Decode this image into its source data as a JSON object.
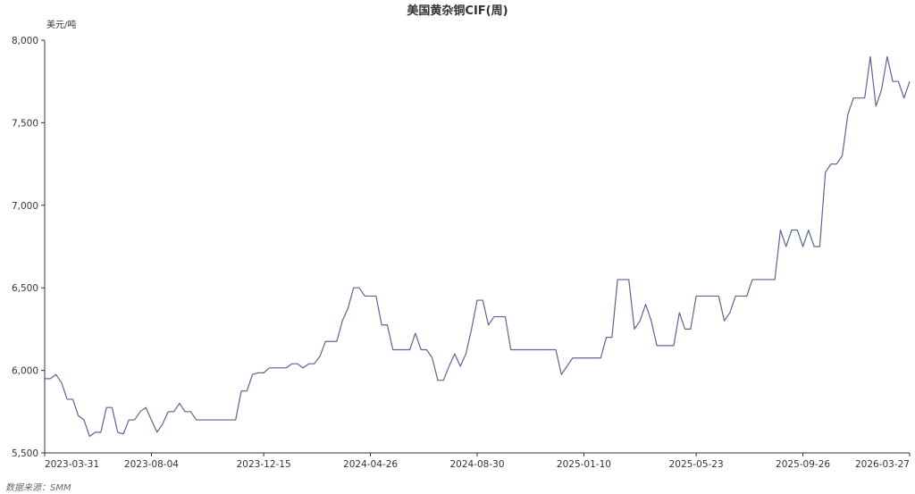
{
  "chart_data": {
    "type": "line",
    "title": "美国黄杂铜CIF(周)",
    "ylabel": "美元/吨",
    "xlabel": "",
    "ylim": [
      5500,
      8000
    ],
    "yticks": [
      "5,500",
      "6,000",
      "6,500",
      "7,000",
      "7,500",
      "8,000"
    ],
    "ytick_values": [
      5500,
      6000,
      6500,
      7000,
      7500,
      8000
    ],
    "xtick_labels": [
      "2023-03-31",
      "2023-08-04",
      "2023-12-15",
      "2024-04-26",
      "2024-08-30",
      "2025-01-10",
      "2025-05-23",
      "2025-09-26",
      "2026-03-27"
    ],
    "line_color": "#5b6596",
    "grid": false,
    "series": [
      {
        "values": [
          5950,
          5950,
          5975,
          5925,
          5825,
          5825,
          5725,
          5700,
          5600,
          5625,
          5625,
          5775,
          5775,
          5625,
          5615,
          5700,
          5700,
          5750,
          5775,
          5700,
          5625,
          5675,
          5750,
          5750,
          5800,
          5750,
          5750,
          5700,
          5700,
          5700,
          5700,
          5700,
          5700,
          5700,
          5700,
          5875,
          5875,
          5975,
          5985,
          5985,
          6015,
          6015,
          6015,
          6015,
          6040,
          6040,
          6015,
          6040,
          6040,
          6085,
          6175,
          6175,
          6175,
          6300,
          6375,
          6500,
          6500,
          6450,
          6450,
          6450,
          6275,
          6275,
          6125,
          6125,
          6125,
          6125,
          6225,
          6125,
          6125,
          6075,
          5940,
          5940,
          6025,
          6100,
          6025,
          6100,
          6250,
          6425,
          6425,
          6275,
          6325,
          6325,
          6325,
          6125,
          6125,
          6125,
          6125,
          6125,
          6125,
          6125,
          6125,
          6125,
          5975,
          6025,
          6075,
          6075,
          6075,
          6075,
          6075,
          6075,
          6200,
          6200,
          6550,
          6550,
          6550,
          6250,
          6300,
          6400,
          6300,
          6150,
          6150,
          6150,
          6150,
          6350,
          6250,
          6250,
          6450,
          6450,
          6450,
          6450,
          6450,
          6300,
          6350,
          6450,
          6450,
          6450,
          6550,
          6550,
          6550,
          6550,
          6550,
          6850,
          6750,
          6850,
          6850,
          6750,
          6850,
          6750,
          6750,
          7200,
          7250,
          7250,
          7300,
          7550,
          7650,
          7650,
          7650,
          7900,
          7600,
          7700,
          7900,
          7750,
          7750,
          7650,
          7750
        ]
      }
    ]
  },
  "source_text": "数据来源：SMM"
}
